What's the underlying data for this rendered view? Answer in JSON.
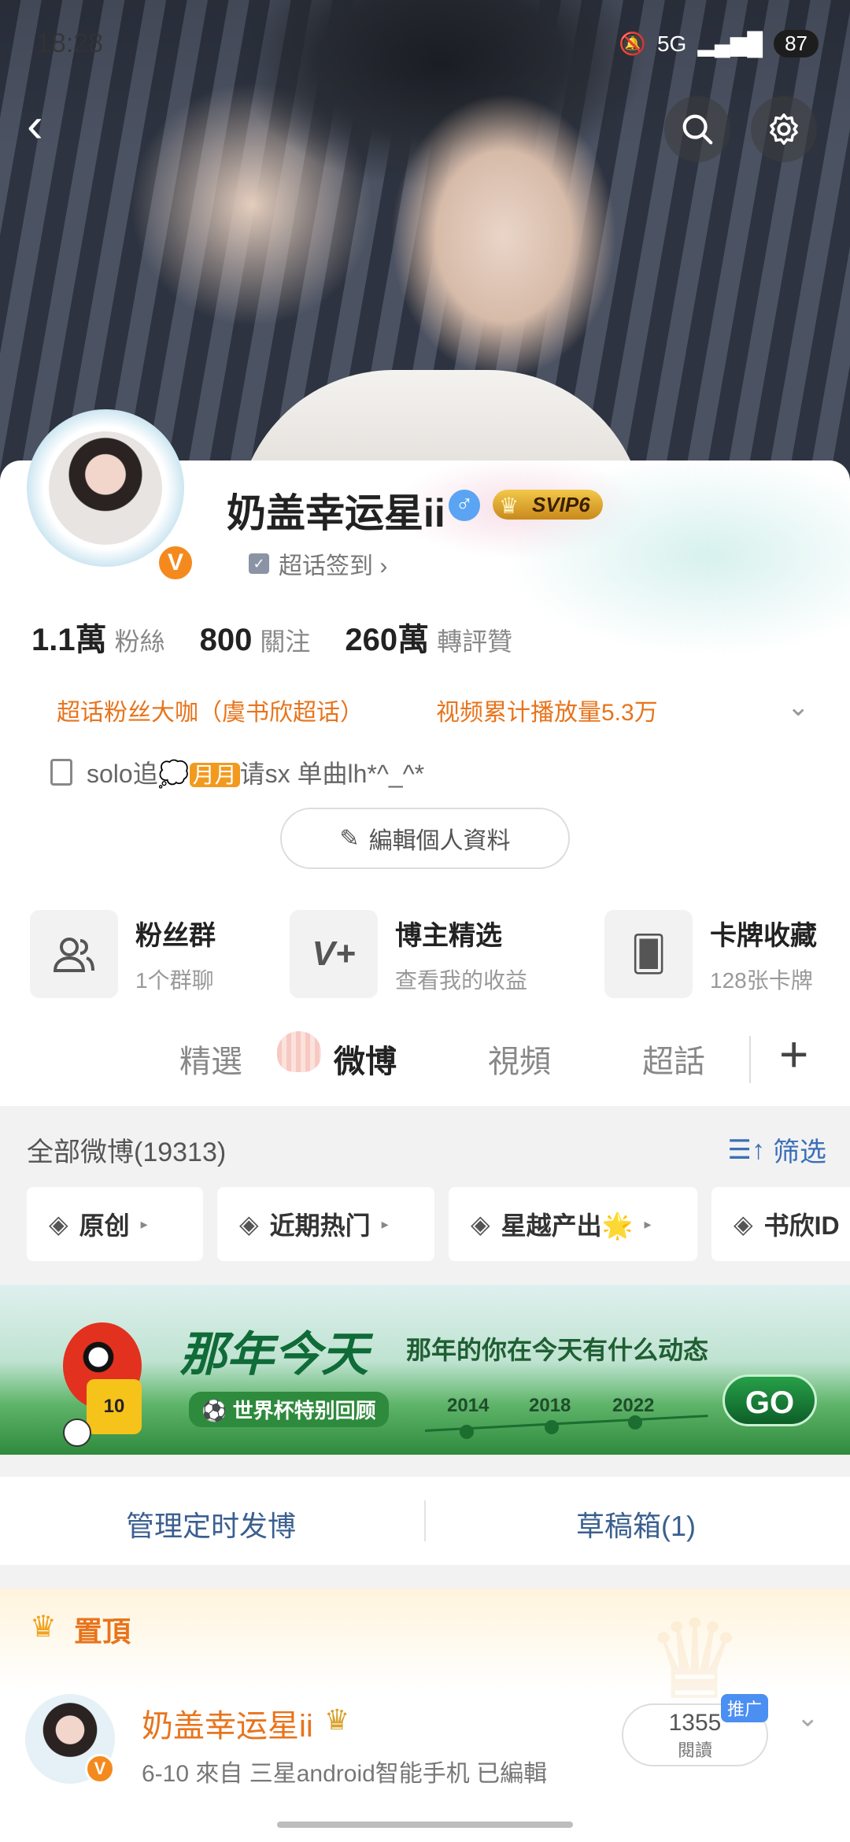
{
  "status_bar": {
    "time": "18:28",
    "network": "5G",
    "battery": "87"
  },
  "profile": {
    "name": "奶盖幸运星ii",
    "vip": "SVIP6",
    "checkin": "超话签到 ›",
    "stats": [
      {
        "num": "1.1萬",
        "label": "粉絲"
      },
      {
        "num": "800",
        "label": "關注"
      },
      {
        "num": "260萬",
        "label": "轉評贊"
      }
    ],
    "tags": [
      "超话粉丝大咖（虞书欣超话）",
      "视频累计播放量5.3万"
    ],
    "bio_prefix": "solo追",
    "bio_month": "月月",
    "bio_suffix": "请sx 单曲lh*^_^*",
    "edit_label": "編輯個人資料"
  },
  "features": [
    {
      "title": "粉丝群",
      "sub": "1个群聊",
      "icon": "group-icon"
    },
    {
      "title": "博主精选",
      "sub": "查看我的收益",
      "icon": "v-plus-icon"
    },
    {
      "title": "卡牌收藏",
      "sub": "128张卡牌",
      "icon": "card-icon"
    }
  ],
  "tabs": {
    "items": [
      "精選",
      "微博",
      "視頻",
      "超話"
    ],
    "active": "微博"
  },
  "feed": {
    "all_label": "全部微博(19313)",
    "filter_label": "筛选",
    "chips": [
      "原创",
      "近期热门",
      "星越产出🌟",
      "书欣ID"
    ]
  },
  "banner": {
    "title": "那年今天",
    "subtitle": "那年的你在今天有什么动态",
    "badge": "⚽ 世界杯特别回顾",
    "years": [
      "2014",
      "2018",
      "2022"
    ],
    "go": "GO",
    "jersey": "10"
  },
  "manage": {
    "scheduled": "管理定时发博",
    "drafts": "草稿箱(1)"
  },
  "pinned": {
    "label": "置頂",
    "name": "奶盖幸运星ii",
    "meta": "6-10   來自 三星android智能手机   已編輯",
    "reads": "1355",
    "reads_label": "閱讀",
    "promo": "推广"
  },
  "colors": {
    "accent_orange": "#e8741c",
    "link_blue": "#3b5f8f",
    "filter_blue": "#3a6fb8"
  }
}
